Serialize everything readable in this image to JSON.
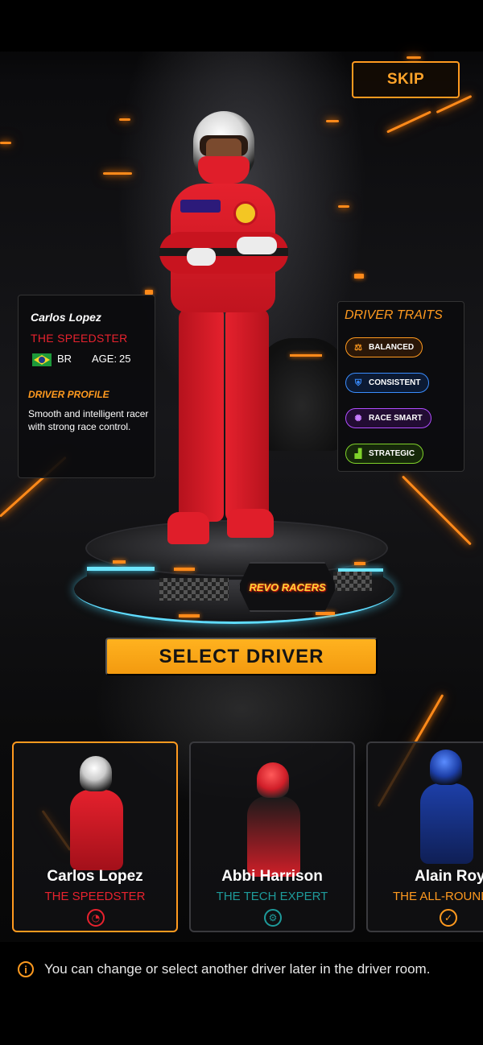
{
  "header": {
    "skip_label": "SKIP"
  },
  "selected_driver": {
    "name": "Carlos Lopez",
    "title": "THE SPEEDSTER",
    "country_code": "BR",
    "age_label": "AGE:",
    "age": "25",
    "profile_heading": "DRIVER PROFILE",
    "profile_text": "Smooth and intelligent racer with strong race control."
  },
  "traits": {
    "heading": "DRIVER TRAITS",
    "items": [
      {
        "label": "BALANCED",
        "icon": "scale-icon",
        "color": "#ff9a1f"
      },
      {
        "label": "CONSISTENT",
        "icon": "shield-check-icon",
        "color": "#3a8dff"
      },
      {
        "label": "RACE SMART",
        "icon": "brain-icon",
        "color": "#b04dff"
      },
      {
        "label": "STRATEGIC",
        "icon": "bar-chart-icon",
        "color": "#7fd12a"
      }
    ]
  },
  "pedestal": {
    "brand": "REVO RACERS"
  },
  "select_button_label": "SELECT DRIVER",
  "drivers": [
    {
      "name": "Carlos Lopez",
      "role": "THE SPEEDSTER",
      "role_color": "#e8222e",
      "icon": "speedometer-icon",
      "selected": true
    },
    {
      "name": "Abbi Harrison",
      "role": "THE TECH EXPERT",
      "role_color": "#1e9a9a",
      "icon": "gear-icon",
      "selected": false
    },
    {
      "name": "Alain Roy",
      "role": "THE ALL-ROUND",
      "role_color": "#ff9a1f",
      "icon": "check-circle-icon",
      "selected": false
    }
  ],
  "footer_note": "You can change or select another driver later in the driver room."
}
